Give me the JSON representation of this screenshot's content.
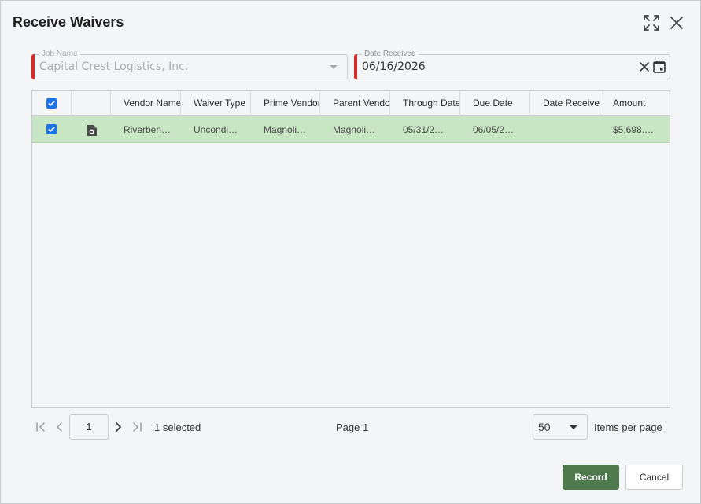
{
  "dialog": {
    "title": "Receive Waivers"
  },
  "fields": {
    "job_name": {
      "label": "Job Name",
      "value": "Capital Crest Logistics, Inc."
    },
    "date_received": {
      "label": "Date Received",
      "value": "06/16/2026"
    }
  },
  "table": {
    "columns": [
      "Vendor Name",
      "Waiver Type",
      "Prime Vendor",
      "Parent Vendor",
      "Through Date",
      "Due Date",
      "Date Received",
      "Amount"
    ],
    "rows": [
      {
        "selected": true,
        "cells": [
          "Riverben…",
          "Uncondi…",
          "Magnoli…",
          "Magnoli…",
          "05/31/2…",
          "06/05/2…",
          "",
          "$5,698.…"
        ]
      }
    ]
  },
  "pager": {
    "current_page": "1",
    "selected_text": "1 selected",
    "page_label": "Page 1",
    "items_per_page_value": "50",
    "items_per_page_label": "Items per page"
  },
  "actions": {
    "record_label": "Record",
    "cancel_label": "Cancel"
  },
  "colors": {
    "accent": "#4f7a4d",
    "selected_row": "#c9e6c4",
    "required": "#d62b2b",
    "checkbox": "#1a73e8"
  },
  "icons": [
    "maximize-icon",
    "close-icon",
    "chevron-down-icon",
    "clear-icon",
    "calendar-icon",
    "document-search-icon",
    "first-page-icon",
    "prev-page-icon",
    "next-page-icon",
    "last-page-icon"
  ]
}
